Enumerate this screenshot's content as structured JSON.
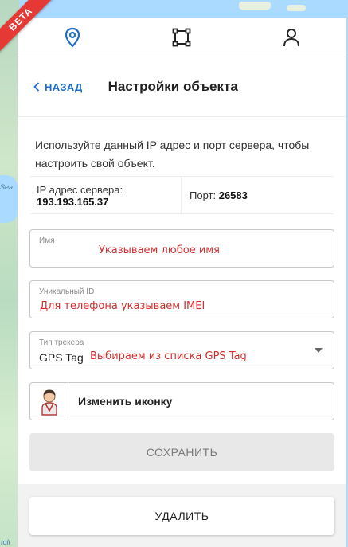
{
  "ribbon": {
    "label": "BETA",
    "color": "#e53935"
  },
  "map": {
    "labels": [
      "Sea",
      "toll"
    ]
  },
  "nav": {
    "tabs": [
      {
        "icon": "map-pin-icon",
        "active": true
      },
      {
        "icon": "geofence-square-icon",
        "active": false
      },
      {
        "icon": "user-icon",
        "active": false
      }
    ]
  },
  "header": {
    "back_label": "НАЗАД",
    "title": "Настройки объекта"
  },
  "info": {
    "text": "Используйте данный IP адрес и порт сервера, чтобы настроить свой объект.",
    "server_label": "IP адрес сервера:",
    "server_value": "193.193.165.37",
    "port_label": "Порт:",
    "port_value": "26583"
  },
  "form": {
    "name": {
      "label": "Имя",
      "value": "",
      "annotation": "Указываем любое имя"
    },
    "unique_id": {
      "label": "Уникальный ID",
      "value": "",
      "annotation": "Для телефона указываем IMEI"
    },
    "tracker_type": {
      "label": "Тип трекера",
      "value": "GPS Tag",
      "annotation": "Выбираем из списка GPS Tag"
    },
    "icon_button_label": "Изменить иконку"
  },
  "actions": {
    "save_label": "СОХРАНИТЬ",
    "delete_label": "УДАЛИТЬ"
  },
  "colors": {
    "accent": "#1e6ec8",
    "annotation": "#d32f2f"
  }
}
